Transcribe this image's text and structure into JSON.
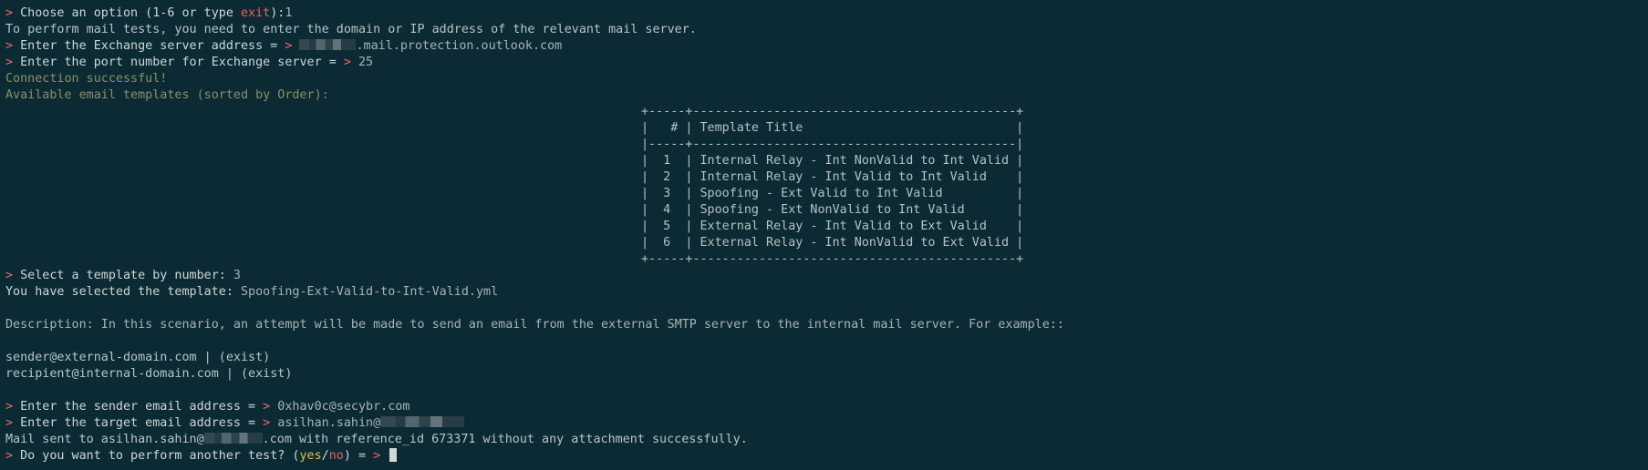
{
  "terminal": {
    "line1": {
      "prompt": ">",
      "text_before": " Choose an option (1-6 or type ",
      "exit_word": "exit",
      "text_after": "):",
      "answer": "1"
    },
    "line2": "To perform mail tests, you need to enter the domain or IP address of the relevant mail server.",
    "line3": {
      "prompt": ">",
      "label": " Enter the Exchange server address = ",
      "arrow": ">",
      "value_suffix": ".mail.protection.outlook.com"
    },
    "line4": {
      "prompt": ">",
      "label": " Enter the port number for Exchange server = ",
      "arrow": ">",
      "value": "25"
    },
    "line5": "Connection successful!",
    "line6": "Available email templates (sorted by Order):",
    "table": {
      "border": "+-----+--------------------------------------------+",
      "header": "|   # | Template Title                             |",
      "separator": "|-----+--------------------------------------------|",
      "rows": [
        "|  1  | Internal Relay - Int NonValid to Int Valid |",
        "|  2  | Internal Relay - Int Valid to Int Valid    |",
        "|  3  | Spoofing - Ext Valid to Int Valid          |",
        "|  4  | Spoofing - Ext NonValid to Int Valid       |",
        "|  5  | External Relay - Int Valid to Ext Valid    |",
        "|  6  | External Relay - Int NonValid to Ext Valid |"
      ]
    },
    "line_select": {
      "prompt": ">",
      "label": " Select a template by number: ",
      "value": "3"
    },
    "line_selected": {
      "label": "You have selected the template: ",
      "value": "Spoofing-Ext-Valid-to-Int-Valid.yml"
    },
    "description": "Description: In this scenario, an attempt will be made to send an email from the external SMTP server to the internal mail server. For example::",
    "example1": "sender@external-domain.com | (exist)",
    "example2": "recipient@internal-domain.com | (exist)",
    "line_sender": {
      "prompt": ">",
      "label": " Enter the sender email address = ",
      "arrow": ">",
      "value": " 0xhav0c@secybr.com"
    },
    "line_target": {
      "prompt": ">",
      "label": " Enter the target email address = ",
      "arrow": ">",
      "value_prefix": " asilhan.sahin@"
    },
    "line_sent": {
      "prefix": "Mail sent to asilhan.sahin@",
      "suffix": ".com with reference_id 673371 without any attachment successfully."
    },
    "line_again": {
      "prompt": ">",
      "label": " Do you want to perform another test? (",
      "yes": "yes",
      "slash": "/",
      "no": "no",
      "close": ") = ",
      "arrow": "> "
    }
  },
  "colors": {
    "background": "#0b2a33",
    "prompt": "#ef6a6a",
    "success": "#8c8f6a",
    "yes": "#d6c64e"
  }
}
